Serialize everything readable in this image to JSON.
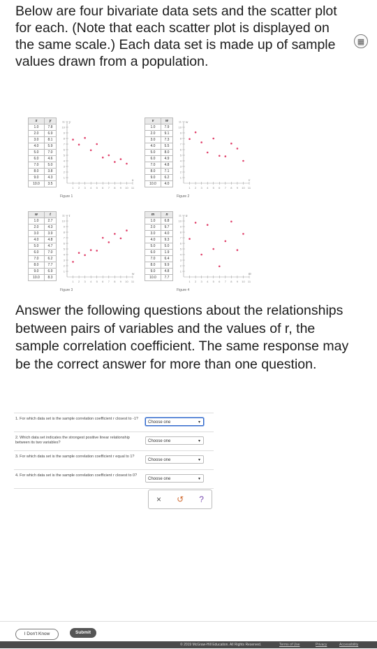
{
  "intro_text": "Below are four bivariate data sets and the scatter plot for each. (Note that each scatter plot is displayed on the same scale.) Each data set is made up of sample values drawn from a population.",
  "calculator_icon": "calculator-icon",
  "figures": [
    {
      "label": "Figure 1",
      "headers": [
        "x",
        "y"
      ],
      "rows": [
        [
          "1.0",
          "7.8"
        ],
        [
          "2.0",
          "6.9"
        ],
        [
          "3.0",
          "8.1"
        ],
        [
          "4.0",
          "5.9"
        ],
        [
          "5.0",
          "7.0"
        ],
        [
          "6.0",
          "4.6"
        ],
        [
          "7.0",
          "5.0"
        ],
        [
          "8.0",
          "3.8"
        ],
        [
          "9.0",
          "4.3"
        ],
        [
          "10.0",
          "3.5"
        ]
      ],
      "points": [
        [
          1,
          7.8
        ],
        [
          2,
          6.9
        ],
        [
          3,
          8.1
        ],
        [
          4,
          5.9
        ],
        [
          5,
          7.0
        ],
        [
          6,
          4.6
        ],
        [
          7,
          5.0
        ],
        [
          8,
          3.8
        ],
        [
          9,
          4.3
        ],
        [
          10,
          3.5
        ]
      ],
      "ylabel": "y",
      "xlabel": "x"
    },
    {
      "label": "Figure 2",
      "headers": [
        "v",
        "w"
      ],
      "rows": [
        [
          "1.0",
          "7.9"
        ],
        [
          "2.0",
          "9.1"
        ],
        [
          "3.0",
          "7.3"
        ],
        [
          "4.0",
          "5.5"
        ],
        [
          "5.0",
          "8.0"
        ],
        [
          "6.0",
          "4.9"
        ],
        [
          "7.0",
          "4.8"
        ],
        [
          "8.0",
          "7.1"
        ],
        [
          "9.0",
          "6.2"
        ],
        [
          "10.0",
          "4.0"
        ]
      ],
      "points": [
        [
          1,
          7.9
        ],
        [
          2,
          9.1
        ],
        [
          3,
          7.3
        ],
        [
          4,
          5.5
        ],
        [
          5,
          8.0
        ],
        [
          6,
          4.9
        ],
        [
          7,
          4.8
        ],
        [
          8,
          7.1
        ],
        [
          9,
          6.2
        ],
        [
          10,
          4.0
        ]
      ],
      "ylabel": "w",
      "xlabel": "v"
    },
    {
      "label": "Figure 3",
      "headers": [
        "w",
        "t"
      ],
      "rows": [
        [
          "1.0",
          "2.7"
        ],
        [
          "2.0",
          "4.3"
        ],
        [
          "3.0",
          "3.9"
        ],
        [
          "4.0",
          "4.8"
        ],
        [
          "5.0",
          "4.7"
        ],
        [
          "6.0",
          "7.0"
        ],
        [
          "7.0",
          "6.2"
        ],
        [
          "8.0",
          "7.7"
        ],
        [
          "9.0",
          "6.9"
        ],
        [
          "10.0",
          "8.3"
        ]
      ],
      "points": [
        [
          1,
          2.7
        ],
        [
          2,
          4.3
        ],
        [
          3,
          3.9
        ],
        [
          4,
          4.8
        ],
        [
          5,
          4.7
        ],
        [
          6,
          7.0
        ],
        [
          7,
          6.2
        ],
        [
          8,
          7.7
        ],
        [
          9,
          6.9
        ],
        [
          10,
          8.3
        ]
      ],
      "ylabel": "t",
      "xlabel": "w"
    },
    {
      "label": "Figure 4",
      "headers": [
        "m",
        "n"
      ],
      "rows": [
        [
          "1.0",
          "6.8"
        ],
        [
          "2.0",
          "9.7"
        ],
        [
          "3.0",
          "4.0"
        ],
        [
          "4.0",
          "9.3"
        ],
        [
          "5.0",
          "5.0"
        ],
        [
          "6.0",
          "1.9"
        ],
        [
          "7.0",
          "6.4"
        ],
        [
          "8.0",
          "9.9"
        ],
        [
          "9.0",
          "4.8"
        ],
        [
          "10.0",
          "7.7"
        ]
      ],
      "points": [
        [
          1,
          6.8
        ],
        [
          2,
          9.7
        ],
        [
          3,
          4.0
        ],
        [
          4,
          9.3
        ],
        [
          5,
          5.0
        ],
        [
          6,
          1.9
        ],
        [
          7,
          6.4
        ],
        [
          8,
          9.9
        ],
        [
          9,
          4.8
        ],
        [
          10,
          7.7
        ]
      ],
      "ylabel": "n",
      "xlabel": "m"
    }
  ],
  "axis": {
    "xmax": 11,
    "ymax": 11,
    "tick_labels_x": "1 2 3 4 5 6 7 8 9 10 11"
  },
  "chart_colors": {
    "point": "#e0406a",
    "axis": "#999999"
  },
  "question_text": "Answer the following questions about the relationships between pairs of variables and the values of r, the sample correlation coefficient. The same response may be the correct answer for more than one question.",
  "questions": [
    {
      "text": "1. For which data set is the sample correlation coefficient r closest to -1?",
      "select": "Choose one"
    },
    {
      "text": "2. Which data set indicates the strongest positive linear relationship between its two variables?",
      "select": "Choose one"
    },
    {
      "text": "3. For which data set is the sample correlation coefficient r equal to 1?",
      "select": "Choose one"
    },
    {
      "text": "4. For which data set is the sample correlation coefficient r closest to 0?",
      "select": "Choose one"
    }
  ],
  "actions": {
    "clear": "×",
    "undo": "↺",
    "help": "?"
  },
  "footer": {
    "dont_know": "I Don't Know",
    "submit": "Submit",
    "copyright": "© 2019 McGraw-Hill Education. All Rights Reserved.",
    "terms": "Terms of Use",
    "privacy": "Privacy",
    "accessibility": "Accessibility"
  }
}
